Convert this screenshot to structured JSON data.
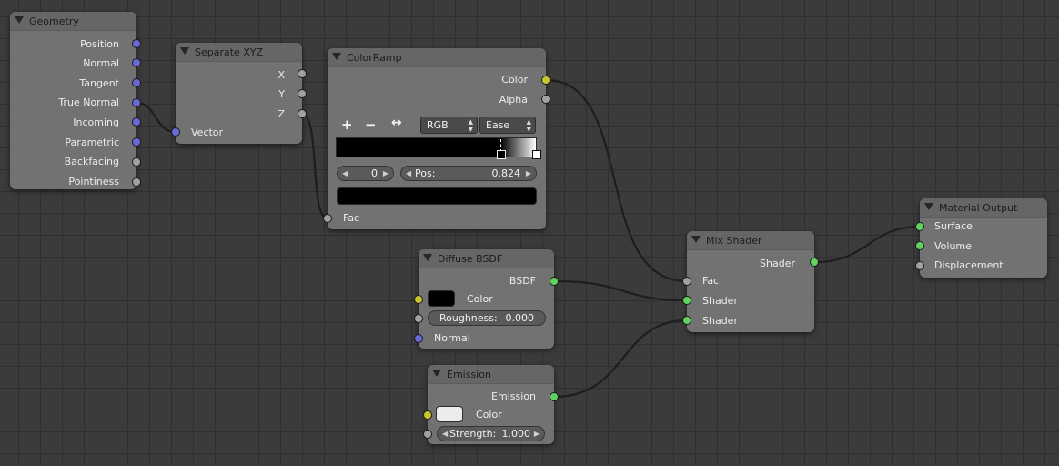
{
  "nodes": {
    "geometry": {
      "title": "Geometry",
      "outputs": [
        "Position",
        "Normal",
        "Tangent",
        "True Normal",
        "Incoming",
        "Parametric",
        "Backfacing",
        "Pointiness"
      ]
    },
    "separate_xyz": {
      "title": "Separate XYZ",
      "outputs": [
        "X",
        "Y",
        "Z"
      ],
      "inputs": [
        "Vector"
      ]
    },
    "color_ramp": {
      "title": "ColorRamp",
      "outputs": [
        "Color",
        "Alpha"
      ],
      "toolbar": {
        "add": "+",
        "remove": "−",
        "flip": "↔"
      },
      "color_mode": "RGB",
      "interpolation": "Ease",
      "stop_index": "0",
      "pos_label": "Pos:",
      "pos_value": "0.824",
      "active_color": "#000000",
      "inputs": [
        "Fac"
      ]
    },
    "diffuse_bsdf": {
      "title": "Diffuse BSDF",
      "outputs": [
        "BSDF"
      ],
      "color_label": "Color",
      "color_value": "#000000",
      "roughness_label": "Roughness:",
      "roughness_value": "0.000",
      "normal_label": "Normal"
    },
    "emission": {
      "title": "Emission",
      "outputs": [
        "Emission"
      ],
      "color_label": "Color",
      "color_value": "#ececec",
      "strength_label": "Strength:",
      "strength_value": "1.000"
    },
    "mix_shader": {
      "title": "Mix Shader",
      "outputs": [
        "Shader"
      ],
      "inputs": [
        "Fac",
        "Shader",
        "Shader"
      ]
    },
    "material_output": {
      "title": "Material Output",
      "inputs": [
        "Surface",
        "Volume",
        "Displacement"
      ]
    }
  },
  "colors": {
    "vector_socket": "#6868d6",
    "float_socket": "#a1a1a1",
    "shader_socket": "#5fd25f",
    "color_socket": "#c8c729",
    "node_body": "#727272",
    "background": "#3b3b3b"
  }
}
